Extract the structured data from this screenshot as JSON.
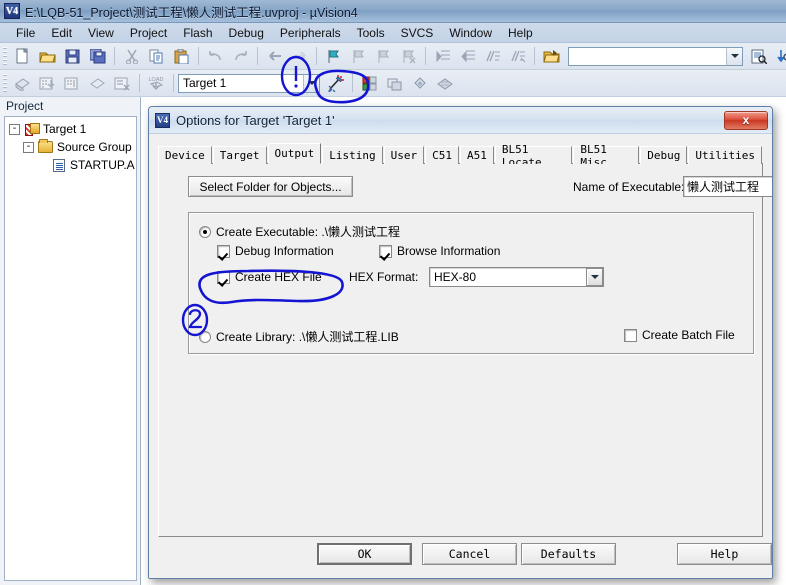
{
  "window": {
    "title": "E:\\LQB-51_Project\\测试工程\\懒人测试工程.uvproj - µVision4",
    "app_icon_label": "V4"
  },
  "menubar": {
    "items": [
      {
        "label": "File"
      },
      {
        "label": "Edit"
      },
      {
        "label": "View"
      },
      {
        "label": "Project"
      },
      {
        "label": "Flash"
      },
      {
        "label": "Debug"
      },
      {
        "label": "Peripherals"
      },
      {
        "label": "Tools"
      },
      {
        "label": "SVCS"
      },
      {
        "label": "Window"
      },
      {
        "label": "Help"
      }
    ]
  },
  "toolbar_row1": {
    "icons": [
      "new-file-icon",
      "open-file-icon",
      "save-icon",
      "save-all-icon",
      "cut-icon",
      "copy-icon",
      "paste-icon",
      "undo-icon",
      "redo-icon",
      "navigate-back-icon",
      "navigate-forward-icon",
      "bookmark-toggle-icon",
      "bookmark-prev-icon",
      "bookmark-next-icon",
      "bookmark-clear-icon",
      "indent-icon",
      "outdent-icon",
      "comment-icon",
      "uncomment-icon",
      "open-folder-icon"
    ],
    "find_combo_value": "",
    "find_combo_placeholder": "",
    "trailing_icons": [
      "find-in-files-icon",
      "find-next-icon",
      "browse-symbols-icon"
    ]
  },
  "toolbar_row2": {
    "icons": [
      "translate-icon",
      "build-target-icon",
      "rebuild-all-icon",
      "batch-build-icon",
      "stop-build-icon",
      "download-icon"
    ],
    "target_combo_value": "Target 1",
    "trailing_icons": [
      "options-for-target-icon",
      "manage-components-icon",
      "multi-project-icon",
      "configure-icon",
      "packs-icon"
    ]
  },
  "project_pane": {
    "title": "Project",
    "tree": [
      {
        "level": 1,
        "label": "Target 1",
        "icon": "target-icon",
        "expander": "-"
      },
      {
        "level": 2,
        "label": "Source Group",
        "icon": "folder-icon",
        "expander": "-"
      },
      {
        "level": 3,
        "label": "STARTUP.A",
        "icon": "asm-file-icon",
        "expander": ""
      }
    ]
  },
  "dialog": {
    "icon_label": "V4",
    "title": "Options for Target 'Target 1'",
    "close_label": "x",
    "tabs": [
      {
        "label": "Device",
        "active": false
      },
      {
        "label": "Target",
        "active": false
      },
      {
        "label": "Output",
        "active": true
      },
      {
        "label": "Listing",
        "active": false
      },
      {
        "label": "User",
        "active": false
      },
      {
        "label": "C51",
        "active": false
      },
      {
        "label": "A51",
        "active": false
      },
      {
        "label": "BL51 Locate",
        "active": false
      },
      {
        "label": "BL51 Misc",
        "active": false
      },
      {
        "label": "Debug",
        "active": false
      },
      {
        "label": "Utilities",
        "active": false
      }
    ],
    "output": {
      "select_folder_button": "Select Folder for Objects...",
      "name_of_executable_label": "Name of Executable:",
      "name_of_executable_value": "懒人测试工程",
      "create_executable_label": "Create Executable:  .\\懒人测试工程",
      "create_executable_checked": true,
      "debug_information_label": "Debug Information",
      "debug_information_checked": true,
      "browse_information_label": "Browse Information",
      "browse_information_checked": true,
      "create_hex_file_label": "Create HEX File",
      "create_hex_file_checked": true,
      "hex_format_label": "HEX Format:",
      "hex_format_value": "HEX-80",
      "create_library_label": "Create Library:  .\\懒人测试工程.LIB",
      "create_library_checked": false,
      "create_batch_file_label": "Create Batch File",
      "create_batch_file_checked": false
    },
    "footer": {
      "ok": "OK",
      "cancel": "Cancel",
      "defaults": "Defaults",
      "help": "Help"
    }
  },
  "annotations": {
    "color": "#1414d2",
    "marks": [
      {
        "name": "callout-1",
        "label": "①"
      },
      {
        "name": "callout-2",
        "label": "②"
      }
    ]
  }
}
